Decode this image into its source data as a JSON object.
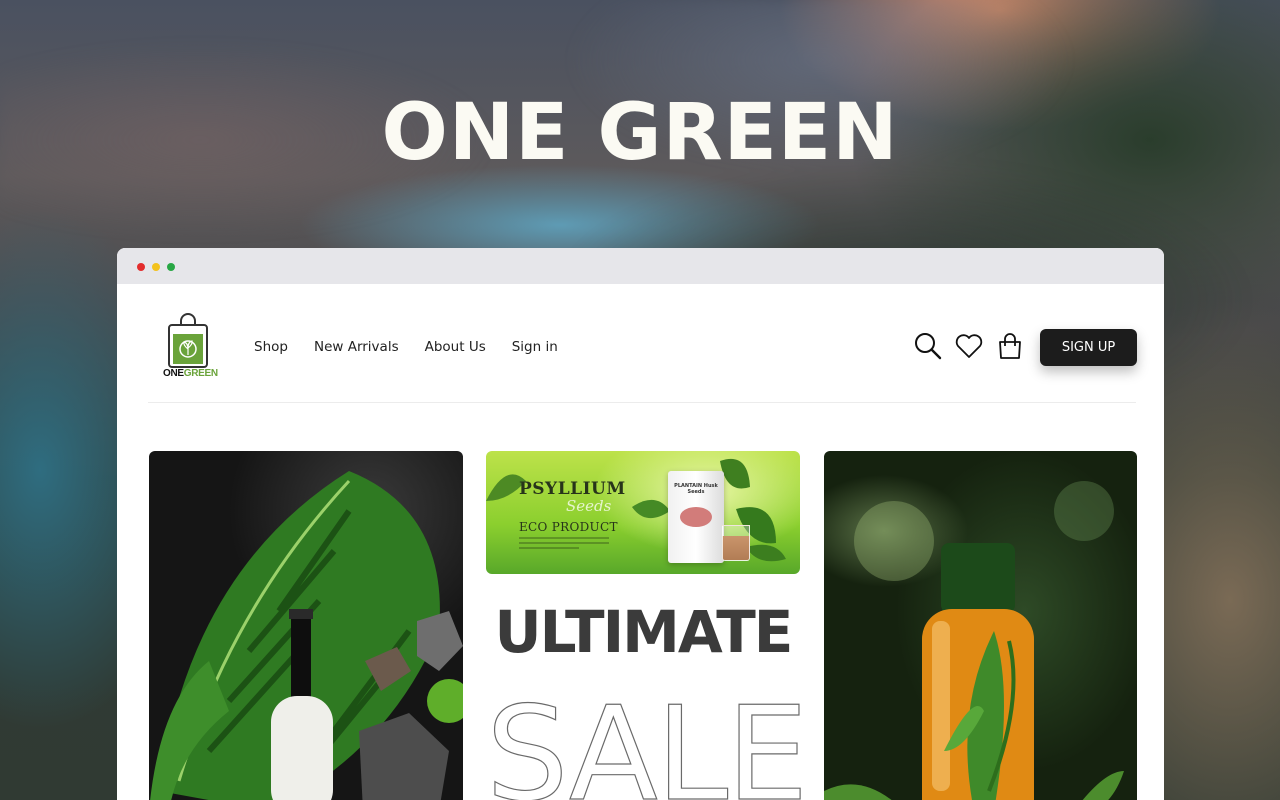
{
  "hero": {
    "title": "ONE GREEN"
  },
  "window": {
    "dots": [
      "close",
      "minimize",
      "maximize"
    ]
  },
  "brand": {
    "logo_text_main": "ONE",
    "logo_text_accent": "GREEN",
    "logo_icon": "shopping-bag-leaf-icon",
    "brand_color": "#6aa33a"
  },
  "nav": {
    "links": [
      "Shop",
      "New Arrivals",
      "About Us",
      "Sign in"
    ],
    "icons": [
      "search-icon",
      "heart-icon",
      "bag-icon"
    ],
    "signup_label": "SIGN UP"
  },
  "banner": {
    "title": "PSYLLIUM",
    "script": "Seeds",
    "subtitle": "ECO PRODUCT",
    "pack_label": "PLANTAIN Husk Seeds"
  },
  "promo": {
    "line1": "ULTIMATE",
    "line2": "SALE"
  },
  "colors": {
    "accent_green": "#6aa33a",
    "button_dark": "#1c1c1c",
    "hero_text": "#fbfaf3"
  }
}
